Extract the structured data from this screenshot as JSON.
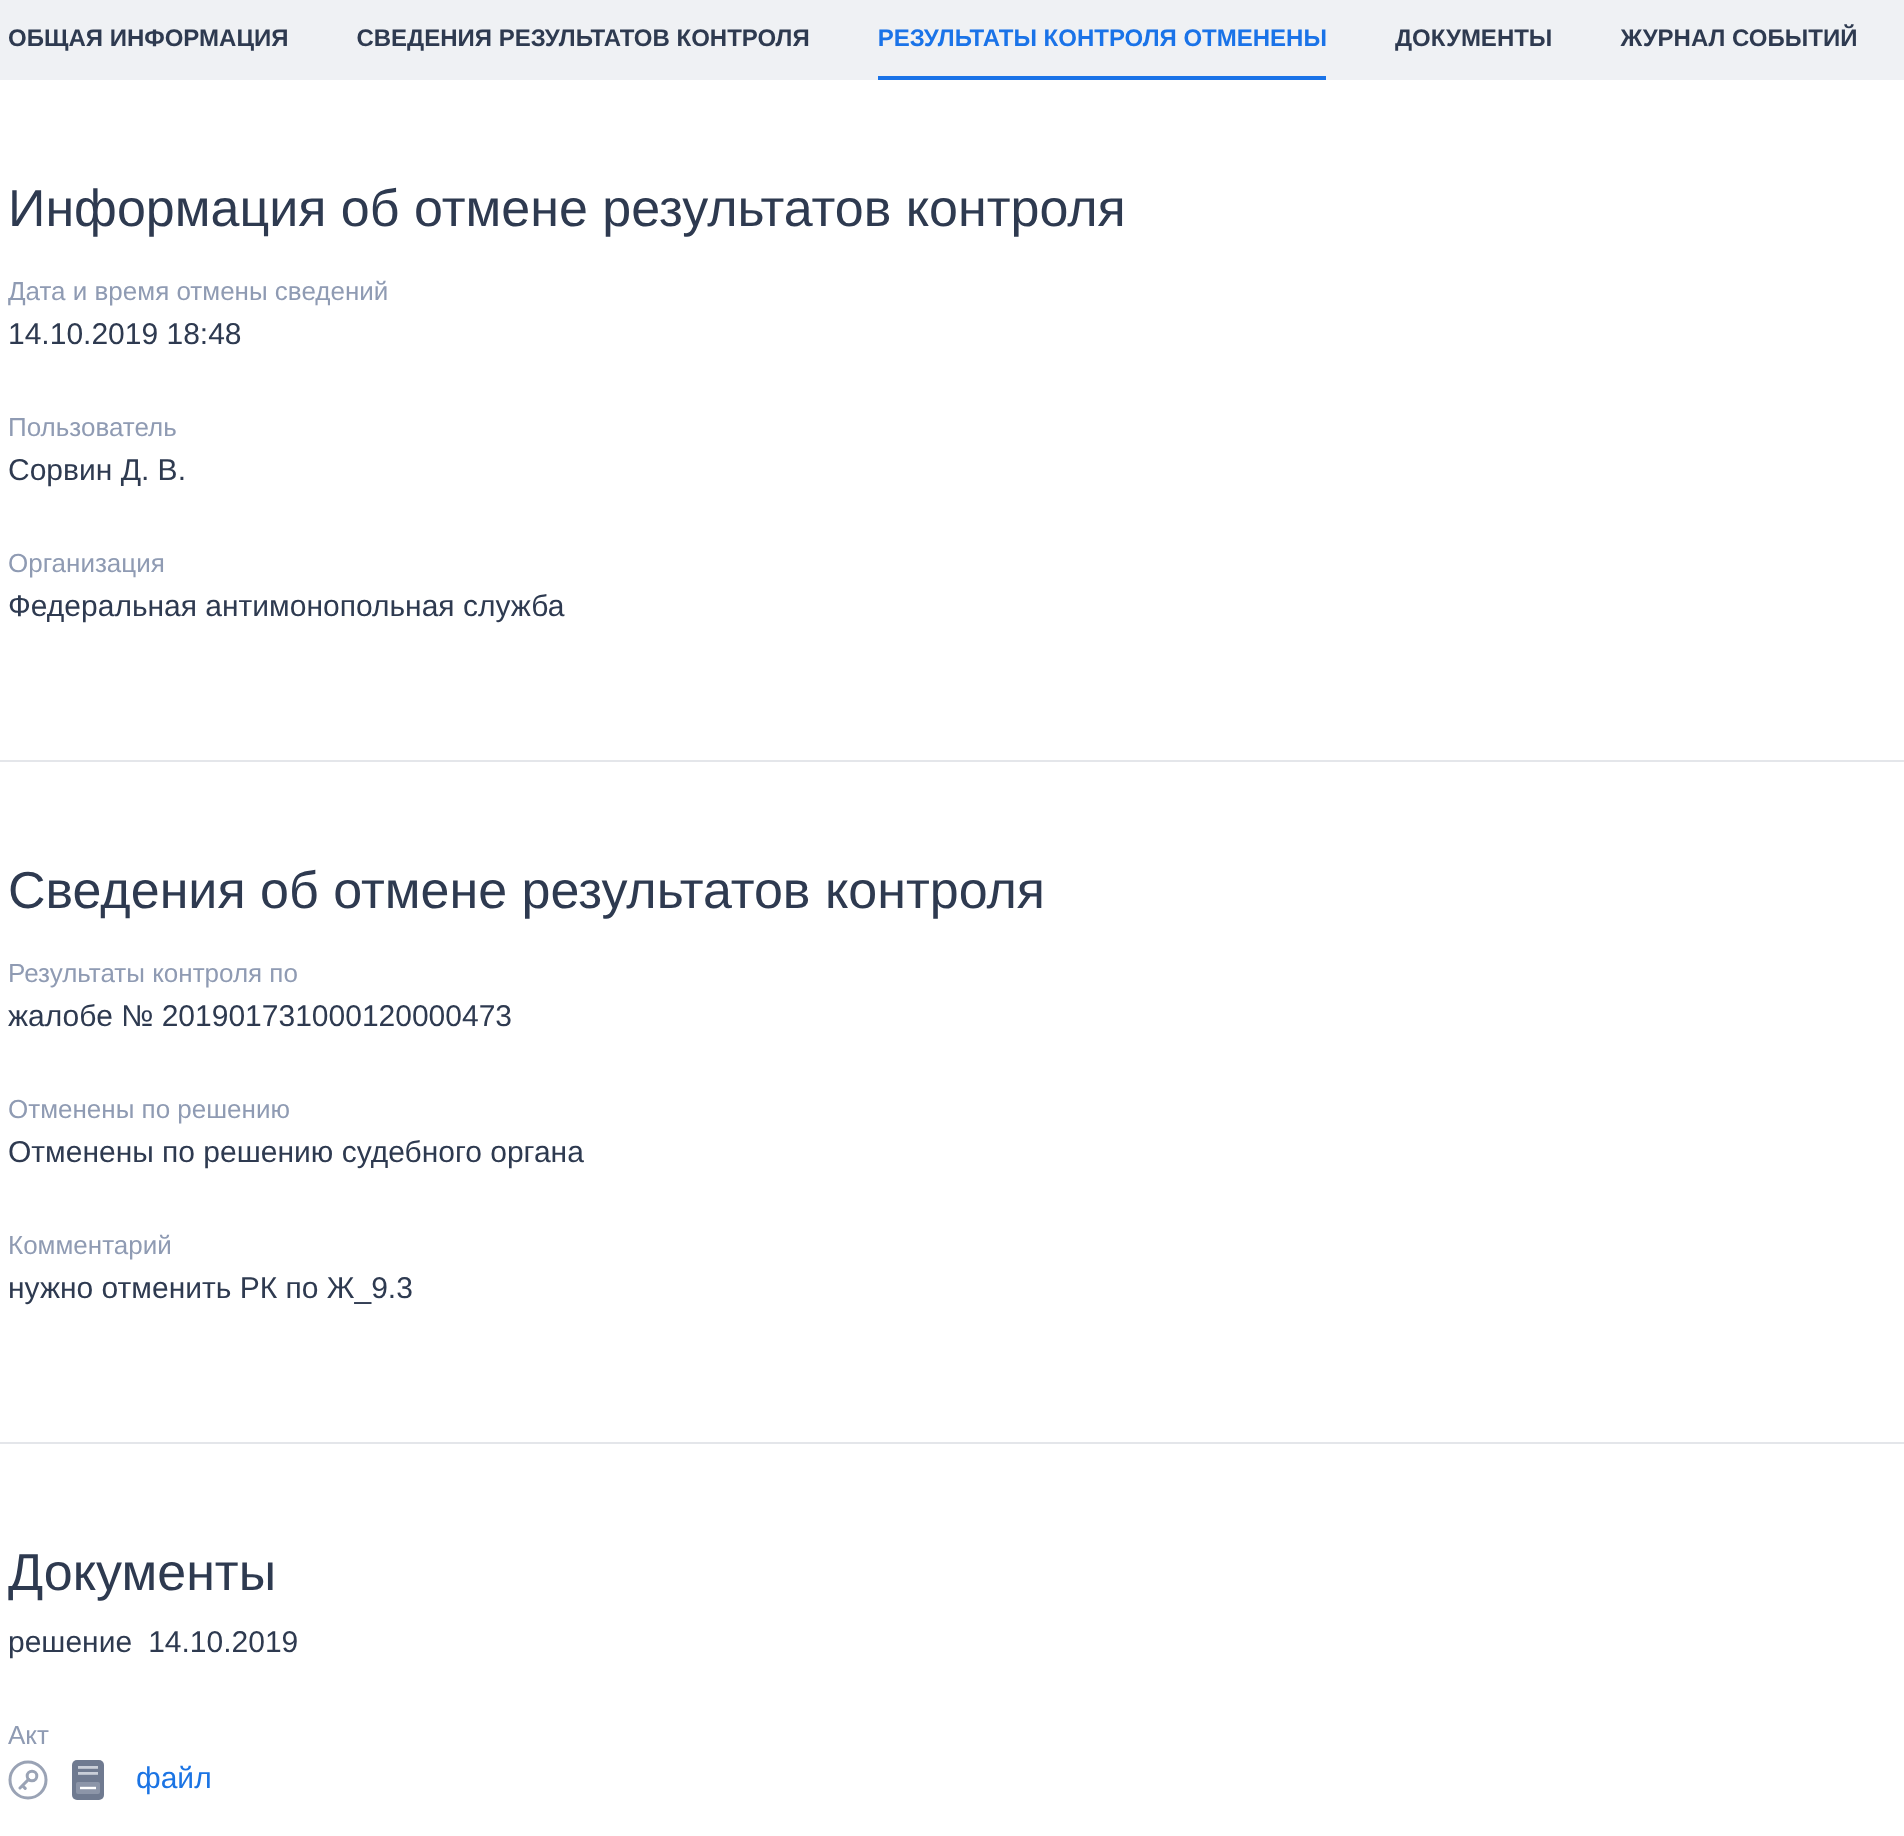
{
  "tabs": [
    {
      "label": "ОБЩАЯ ИНФОРМАЦИЯ",
      "selected": false
    },
    {
      "label": "СВЕДЕНИЯ РЕЗУЛЬТАТОВ КОНТРОЛЯ",
      "selected": false
    },
    {
      "label": "РЕЗУЛЬТАТЫ КОНТРОЛЯ ОТМЕНЕНЫ",
      "selected": true
    },
    {
      "label": "ДОКУМЕНТЫ",
      "selected": false
    },
    {
      "label": "ЖУРНАЛ СОБЫТИЙ",
      "selected": false
    }
  ],
  "sections": [
    {
      "title": "Информация об отмене результатов контроля",
      "fields": [
        {
          "label": "Дата и время отмены сведений",
          "value": "14.10.2019 18:48"
        },
        {
          "label": "Пользователь",
          "value": "Сорвин Д. В."
        },
        {
          "label": "Организация",
          "value": "Федеральная антимонопольная служба"
        }
      ]
    },
    {
      "title": "Сведения об отмене результатов контроля",
      "fields": [
        {
          "label": "Результаты контроля по",
          "value": "жалобе № 201901731000120000473"
        },
        {
          "label": "Отменены по решению",
          "value": "Отменены по решению судебного органа"
        },
        {
          "label": "Комментарий",
          "value": "нужно отменить РК по Ж_9.3"
        }
      ]
    }
  ],
  "documents": {
    "title": "Документы",
    "items": [
      {
        "type": "решение",
        "date": "14.10.2019",
        "attachments": [
          {
            "label": "Акт",
            "link": "файл"
          }
        ]
      }
    ]
  }
}
